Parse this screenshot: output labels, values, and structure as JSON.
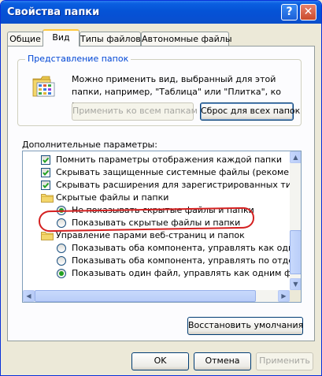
{
  "window": {
    "title": "Свойства папки",
    "help_glyph": "?",
    "close_glyph": "✕"
  },
  "tabs": [
    {
      "label": "Общие",
      "active": false
    },
    {
      "label": "Вид",
      "active": true
    },
    {
      "label": "Типы файлов",
      "active": false
    },
    {
      "label": "Автономные файлы",
      "active": false
    }
  ],
  "folder_view": {
    "legend": "Представление папок",
    "description": "Можно применить вид, выбранный для этой папки, например, \"Таблица\" или \"Плитка\", ко всем папкам.",
    "apply_all_label": "Применить ко всем папкам",
    "reset_all_label": "Сброс для всех папок"
  },
  "advanced": {
    "label": "Дополнительные параметры:",
    "items": [
      {
        "kind": "checkbox",
        "checked": true,
        "indent": 1,
        "text": "Помнить параметры отображения каждой папки"
      },
      {
        "kind": "checkbox",
        "checked": true,
        "indent": 1,
        "text": "Скрывать защищенные системные файлы (рекомендуетс"
      },
      {
        "kind": "checkbox",
        "checked": true,
        "indent": 1,
        "text": "Скрывать расширения для зарегистрированных типов фа"
      },
      {
        "kind": "folder",
        "indent": 1,
        "text": "Скрытые файлы и папки"
      },
      {
        "kind": "radio",
        "checked": true,
        "indent": 2,
        "text": "Не показывать скрытые файлы и папки"
      },
      {
        "kind": "radio",
        "checked": false,
        "indent": 2,
        "text": "Показывать скрытые файлы и папки"
      },
      {
        "kind": "folder",
        "indent": 1,
        "text": "Управление парами веб-страниц и папок"
      },
      {
        "kind": "radio",
        "checked": false,
        "indent": 2,
        "text": "Показывать оба компонента, управлять как одним ф"
      },
      {
        "kind": "radio",
        "checked": false,
        "indent": 2,
        "text": "Показывать оба компонента, управлять по отдельно"
      },
      {
        "kind": "radio",
        "checked": true,
        "indent": 2,
        "text": "Показывать один файл, управлять как одним файло"
      }
    ],
    "restore_defaults_label": "Восстановить умолчания"
  },
  "footer": {
    "ok_label": "OK",
    "cancel_label": "Отмена",
    "apply_label": "Применить"
  },
  "colors": {
    "titlebar": "#0553d6",
    "annotation": "#d42020",
    "legend_text": "#0046d5"
  }
}
